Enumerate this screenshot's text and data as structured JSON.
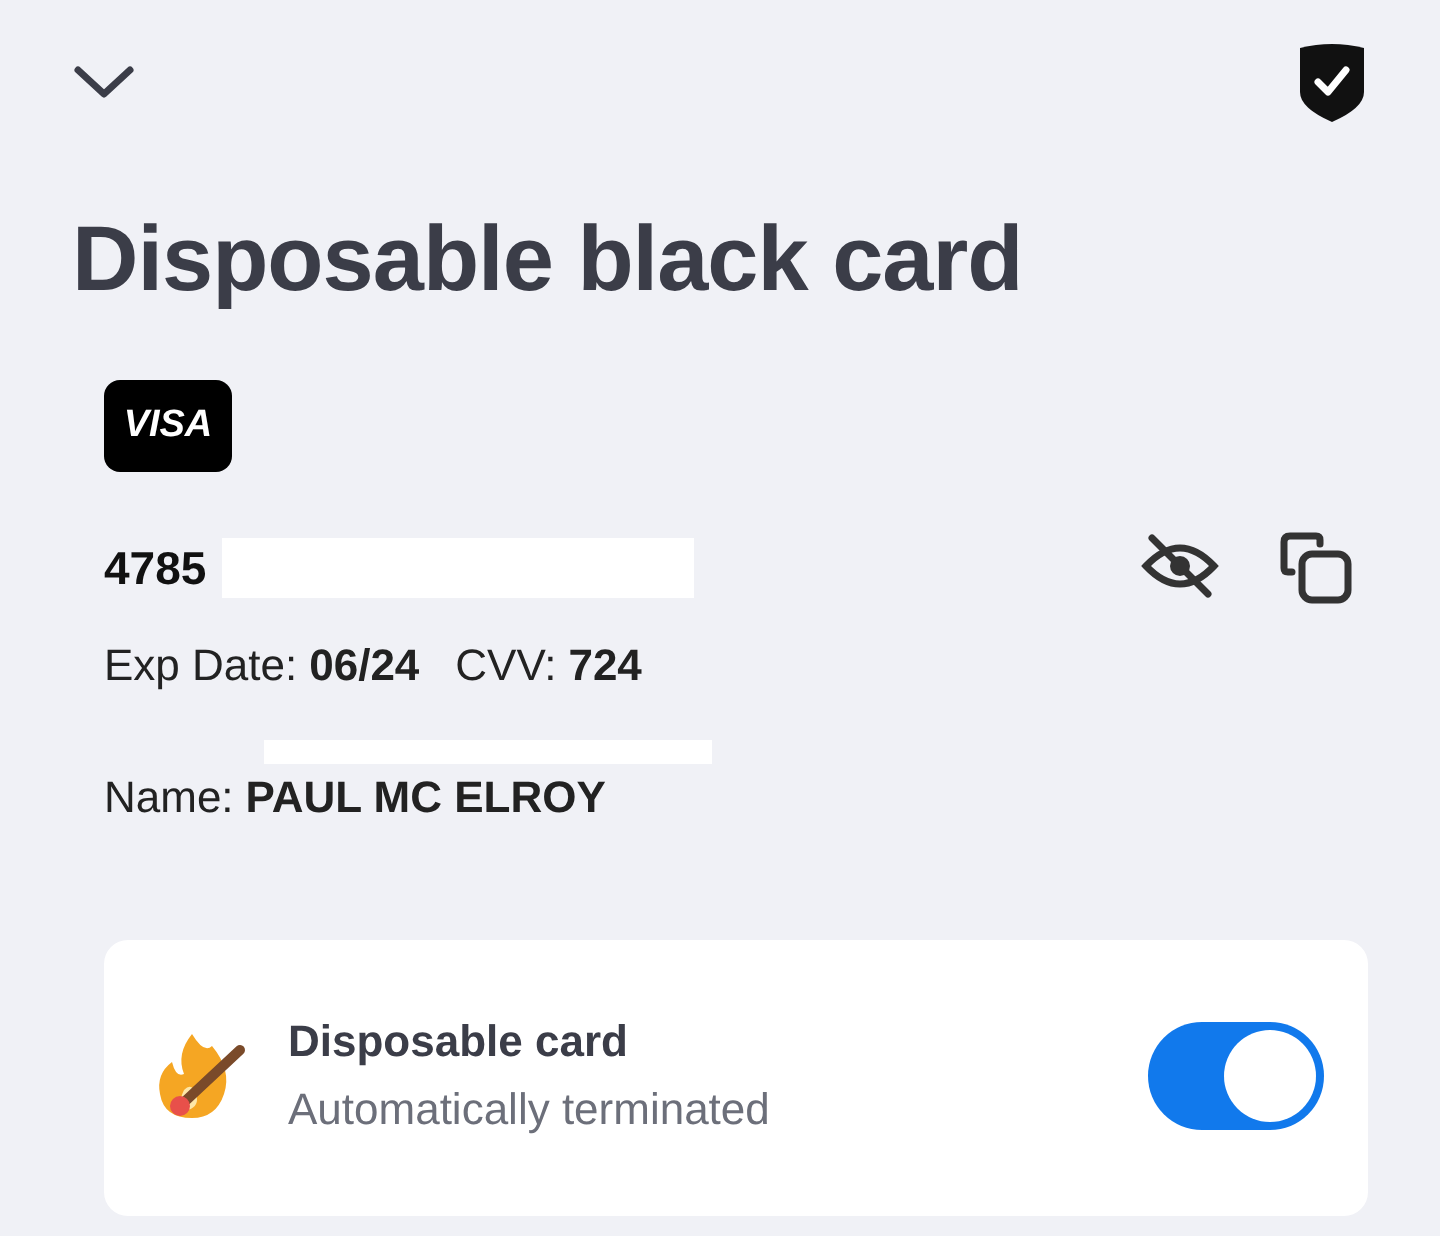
{
  "header": {
    "title": "Disposable black card"
  },
  "card": {
    "brand": "VISA",
    "number": "4785",
    "exp_label": "Exp Date:",
    "exp_value": "06/24",
    "cvv_label": "CVV:",
    "cvv_value": "724",
    "name_label": "Name:",
    "name_value": "PAUL MC ELROY",
    "number_hidden": true
  },
  "setting": {
    "title": "Disposable card",
    "subtitle": "Automatically terminated",
    "on": true
  }
}
